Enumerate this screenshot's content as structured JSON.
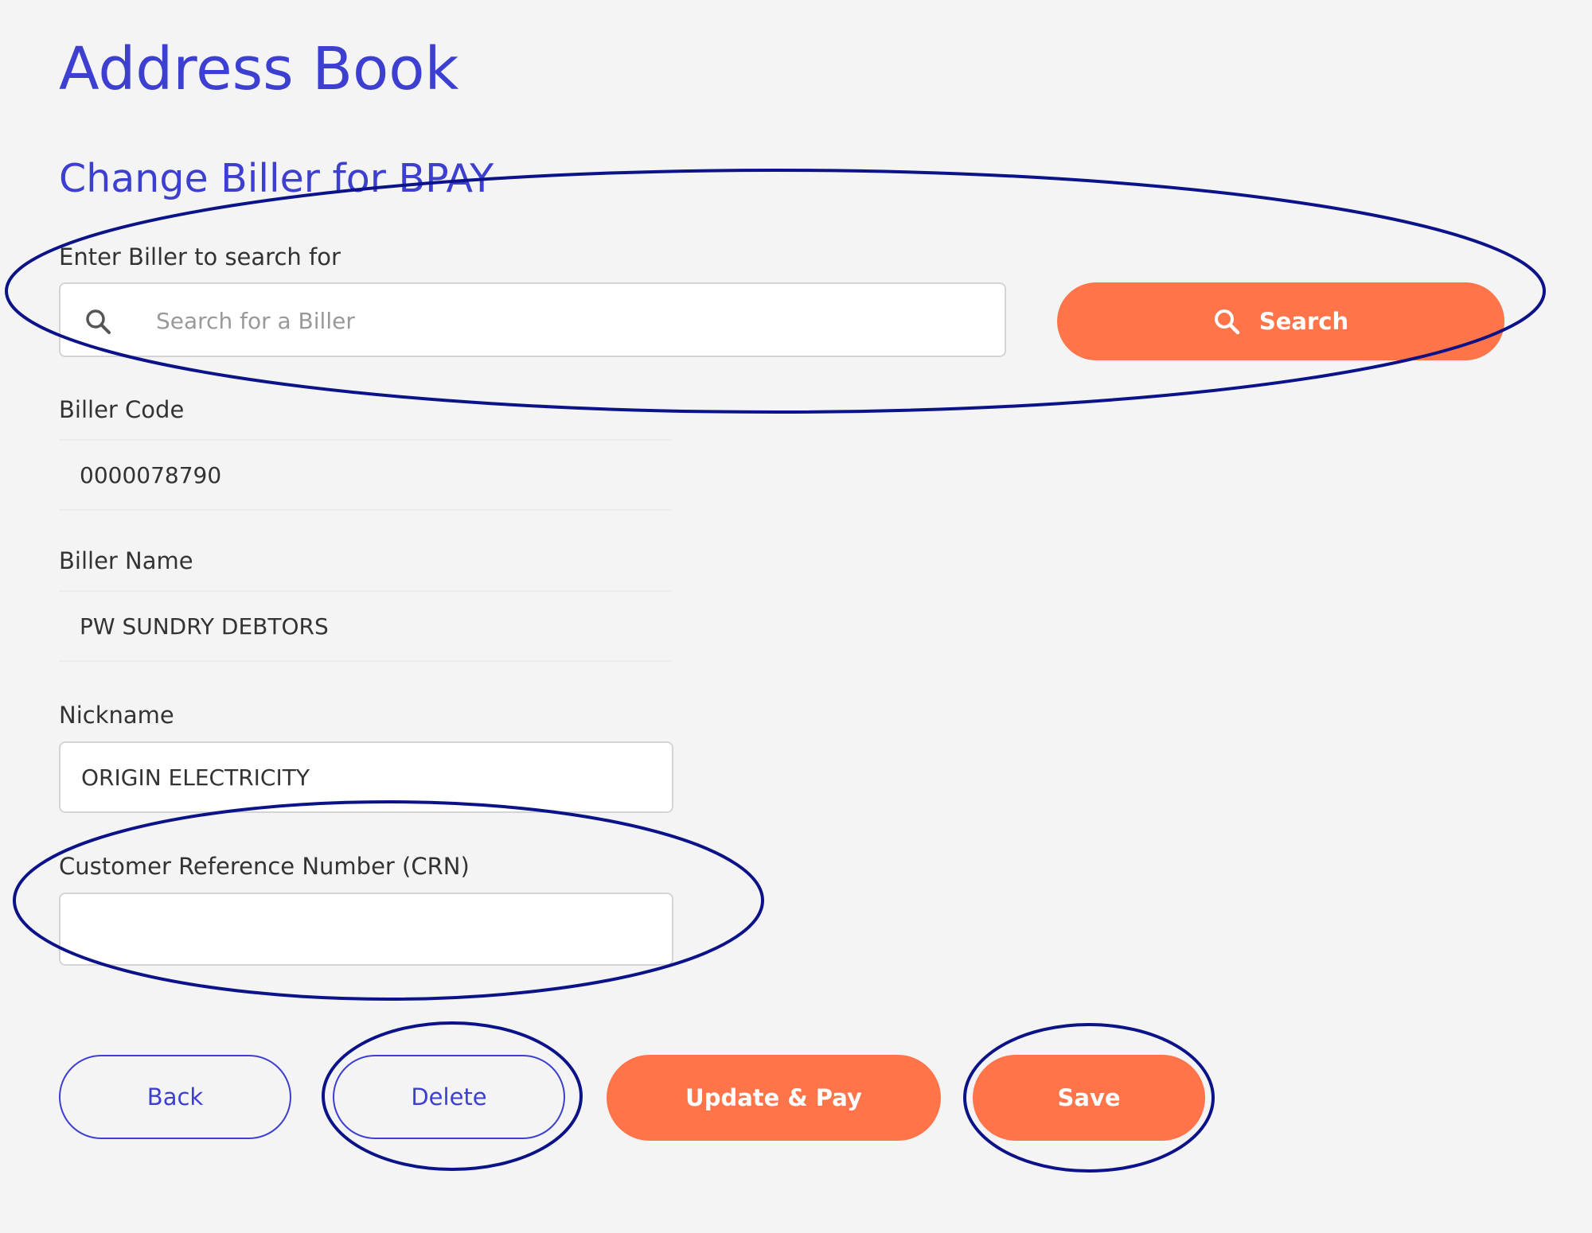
{
  "page": {
    "title": "Address Book",
    "section_title": "Change Biller for BPAY"
  },
  "search": {
    "label": "Enter Biller to search for",
    "placeholder": "Search for a Biller",
    "value": "",
    "button_label": "Search"
  },
  "biller_code": {
    "label": "Biller Code",
    "value": "0000078790"
  },
  "biller_name": {
    "label": "Biller Name",
    "value": "PW SUNDRY DEBTORS"
  },
  "nickname": {
    "label": "Nickname",
    "value": "ORIGIN ELECTRICITY"
  },
  "crn": {
    "label": "Customer Reference Number (CRN)",
    "value": ""
  },
  "actions": {
    "back_label": "Back",
    "delete_label": "Delete",
    "update_pay_label": "Update & Pay",
    "save_label": "Save"
  },
  "icons": {
    "search_field_icon": "search-icon",
    "search_button_icon": "search-icon"
  },
  "colors": {
    "accent_blue": "#3d3fd1",
    "primary_orange": "#ff7449",
    "annotation_navy": "#0c1288",
    "background": "#f4f4f4"
  }
}
